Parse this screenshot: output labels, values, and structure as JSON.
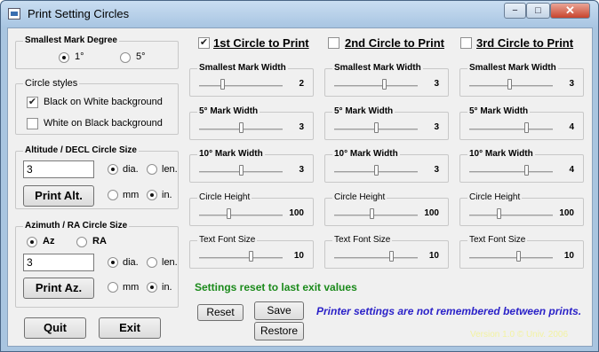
{
  "window": {
    "title": "Print Setting Circles",
    "minimize": "−",
    "maximize": "□",
    "close": "✕"
  },
  "smallest_mark": {
    "title": "Smallest Mark Degree",
    "options": [
      {
        "label": "1°",
        "selected": true
      },
      {
        "label": "5°",
        "selected": false
      }
    ]
  },
  "circle_styles": {
    "title": "Circle styles",
    "options": [
      {
        "label": "Black on White background",
        "checked": true
      },
      {
        "label": "White on Black background",
        "checked": false
      }
    ]
  },
  "altitude": {
    "title": "Altitude / DECL Circle Size",
    "value": "3",
    "dia_label": "dia.",
    "len_label": "len.",
    "dia_selected": true,
    "mm_label": "mm",
    "in_label": "in.",
    "in_selected": true,
    "print_button": "Print Alt."
  },
  "azimuth": {
    "title": "Azimuth / RA Circle Size",
    "az_label": "Az",
    "ra_label": "RA",
    "az_selected": true,
    "value": "3",
    "dia_label": "dia.",
    "len_label": "len.",
    "dia_selected": true,
    "mm_label": "mm",
    "in_label": "in.",
    "in_selected": true,
    "print_button": "Print Az."
  },
  "circles": [
    {
      "header": "1st Circle to Print",
      "checked": true,
      "sliders": [
        {
          "label": "Smallest Mark Width",
          "value": "2",
          "level": 0.28
        },
        {
          "label": "5° Mark Width",
          "value": "3",
          "level": 0.5
        },
        {
          "label": "10° Mark Width",
          "value": "3",
          "level": 0.5
        },
        {
          "label": "Circle Height",
          "value": "100",
          "level": 0.35
        },
        {
          "label": "Text Font Size",
          "value": "10",
          "level": 0.62
        }
      ]
    },
    {
      "header": "2nd Circle to Print",
      "checked": false,
      "sliders": [
        {
          "label": "Smallest Mark Width",
          "value": "3",
          "level": 0.6
        },
        {
          "label": "5° Mark Width",
          "value": "3",
          "level": 0.5
        },
        {
          "label": "10° Mark Width",
          "value": "3",
          "level": 0.5
        },
        {
          "label": "Circle Height",
          "value": "100",
          "level": 0.45
        },
        {
          "label": "Text Font Size",
          "value": "10",
          "level": 0.68
        }
      ]
    },
    {
      "header": "3rd Circle to Print",
      "checked": false,
      "sliders": [
        {
          "label": "Smallest Mark Width",
          "value": "3",
          "level": 0.48
        },
        {
          "label": "5° Mark Width",
          "value": "4",
          "level": 0.68
        },
        {
          "label": "10° Mark Width",
          "value": "4",
          "level": 0.68
        },
        {
          "label": "Circle Height",
          "value": "100",
          "level": 0.35
        },
        {
          "label": "Text Font Size",
          "value": "10",
          "level": 0.58
        }
      ]
    }
  ],
  "status_message": "Settings reset to last exit values",
  "info_message": "Printer settings are not remembered between prints.",
  "version": "Version 1.0   © Univ. 2006",
  "buttons": {
    "reset": "Reset",
    "save": "Save",
    "restore": "Restore",
    "quit": "Quit",
    "exit": "Exit"
  },
  "colors": {
    "status_green": "#1b8a1b",
    "info_blue": "#2b22c8"
  }
}
